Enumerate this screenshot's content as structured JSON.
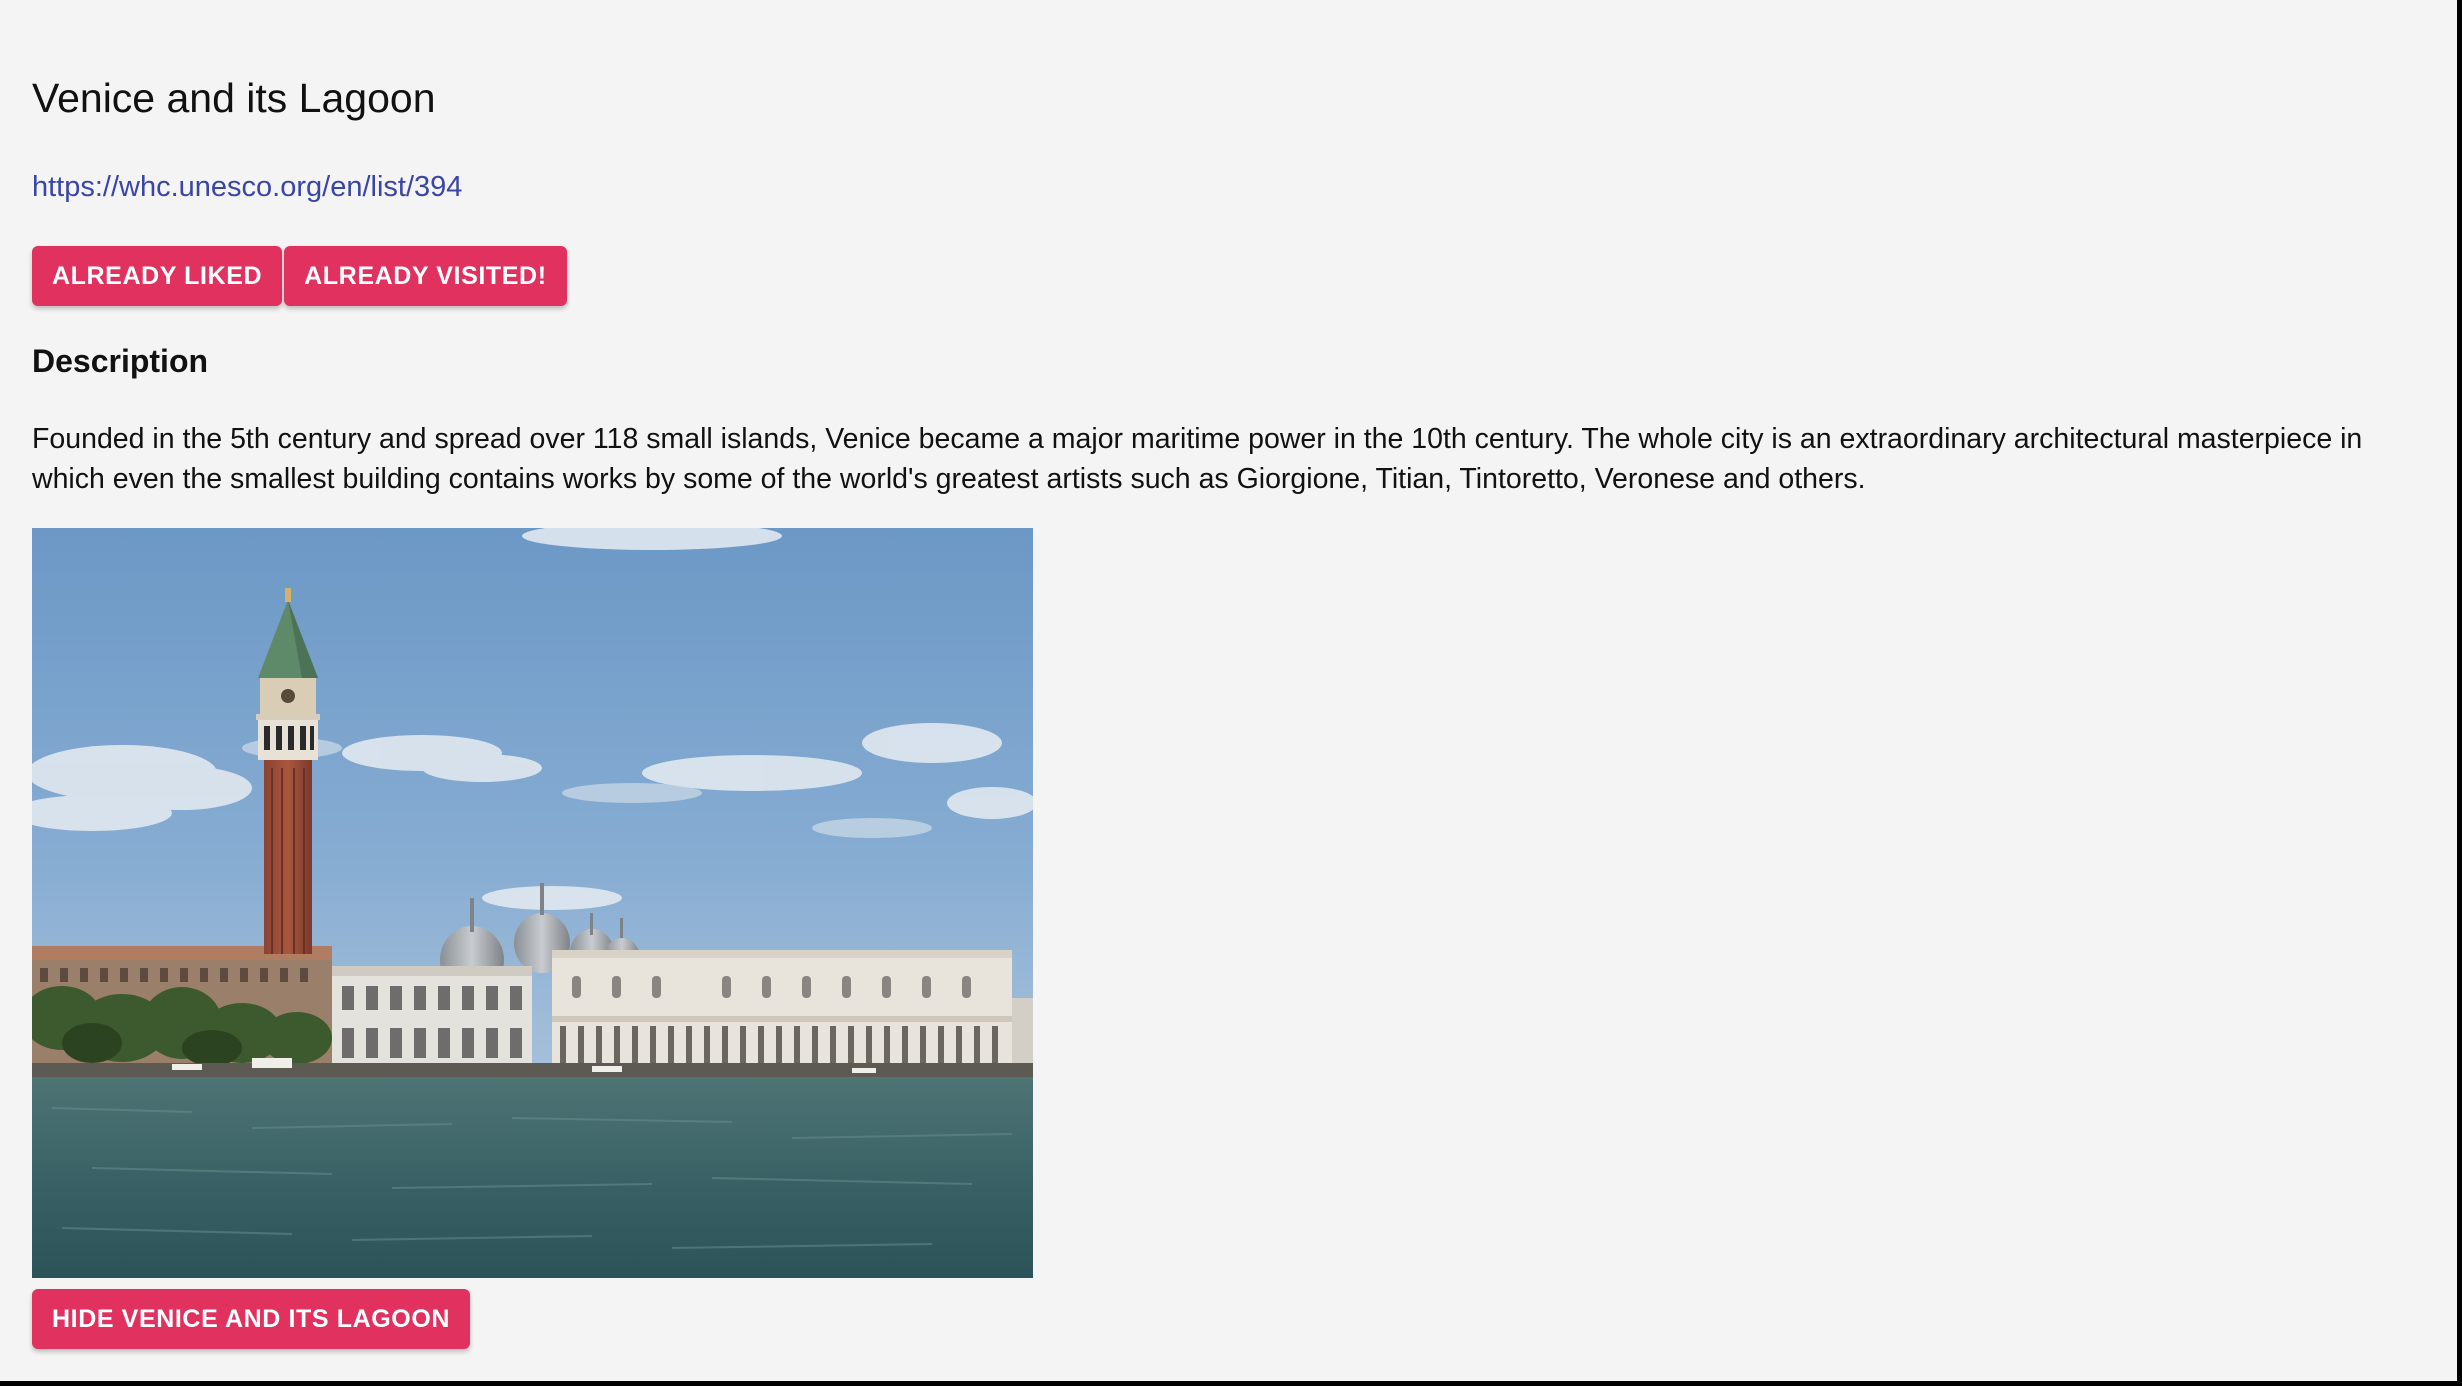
{
  "site": {
    "title": "Venice and its Lagoon",
    "url": "https://whc.unesco.org/en/list/394"
  },
  "actions": {
    "liked_label": "ALREADY LIKED",
    "visited_label": "ALREADY VISITED!",
    "hide_label": "HIDE VENICE AND ITS LAGOON"
  },
  "description": {
    "heading": "Description",
    "text": "Founded in the 5th century and spread over 118 small islands, Venice became a major maritime power in the 10th century. The whole city is an extraordinary architectural masterpiece in which even the smallest building contains works by some of the world's greatest artists such as Giorgione, Titian, Tintoretto, Veronese and others."
  },
  "colors": {
    "button": "#e0315f",
    "link": "#3a46a6",
    "page_background": "#f4f4f4"
  }
}
